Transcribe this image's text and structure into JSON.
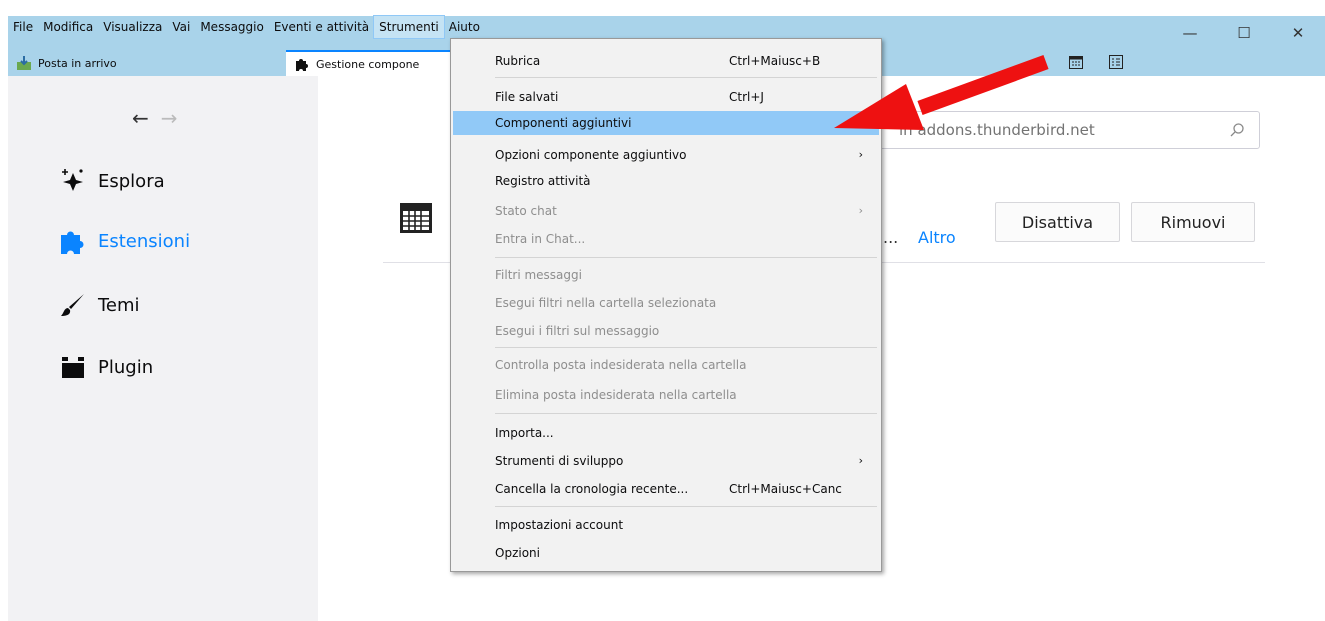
{
  "menubar": {
    "items": [
      "File",
      "Modifica",
      "Visualizza",
      "Vai",
      "Messaggio",
      "Eventi e attività",
      "Strumenti",
      "Aiuto"
    ],
    "active_index": 6
  },
  "window_controls": {
    "minimize": "—",
    "maximize": "☐",
    "close": "✕"
  },
  "tabs": [
    {
      "label": "Posta in arrivo",
      "icon": "inbox-icon"
    },
    {
      "label": "Gestione compone",
      "icon": "puzzle-icon"
    }
  ],
  "toolbar_icons": [
    "calendar-icon",
    "tasks-icon"
  ],
  "sidebar": {
    "back": "←",
    "forward": "→",
    "categories": [
      {
        "label": "Esplora",
        "icon": "sparkle-icon",
        "selected": false
      },
      {
        "label": "Estensioni",
        "icon": "puzzle-icon",
        "selected": true
      },
      {
        "label": "Temi",
        "icon": "brush-icon",
        "selected": false
      },
      {
        "label": "Plugin",
        "icon": "plugin-icon",
        "selected": false
      }
    ]
  },
  "search": {
    "placeholder": "in addons.thunderbird.net"
  },
  "addon": {
    "ellipsis": "...",
    "more_link": "Altro",
    "disable_button": "Disattiva",
    "remove_button": "Rimuovi"
  },
  "dropdown": {
    "items": [
      {
        "label": "Rubrica",
        "shortcut": "Ctrl+Maiusc+B"
      },
      {
        "label": "File salvati",
        "shortcut": "Ctrl+J"
      },
      {
        "label": "Componenti aggiuntivi",
        "highlighted": true
      },
      {
        "label": "Opzioni componente aggiuntivo",
        "submenu": "›"
      },
      {
        "label": "Registro attività"
      },
      {
        "label": "Stato chat",
        "disabled": true,
        "submenu": "›"
      },
      {
        "label": "Entra in Chat...",
        "disabled": true
      },
      {
        "label": "Filtri messaggi",
        "disabled": true
      },
      {
        "label": "Esegui filtri nella cartella selezionata",
        "disabled": true
      },
      {
        "label": "Esegui i filtri sul messaggio",
        "disabled": true
      },
      {
        "label": "Controlla posta indesiderata nella cartella",
        "disabled": true
      },
      {
        "label": "Elimina posta indesiderata nella cartella",
        "disabled": true
      },
      {
        "label": "Importa..."
      },
      {
        "label": "Strumenti di sviluppo",
        "submenu": "›"
      },
      {
        "label": "Cancella la cronologia recente...",
        "shortcut": "Ctrl+Maiusc+Canc"
      },
      {
        "label": "Impostazioni account"
      },
      {
        "label": "Opzioni"
      }
    ]
  },
  "colors": {
    "accent": "#0a84ff",
    "titlebar": "#a9d3ea",
    "highlight": "#91c9f7",
    "annotation": "#ee1111"
  }
}
